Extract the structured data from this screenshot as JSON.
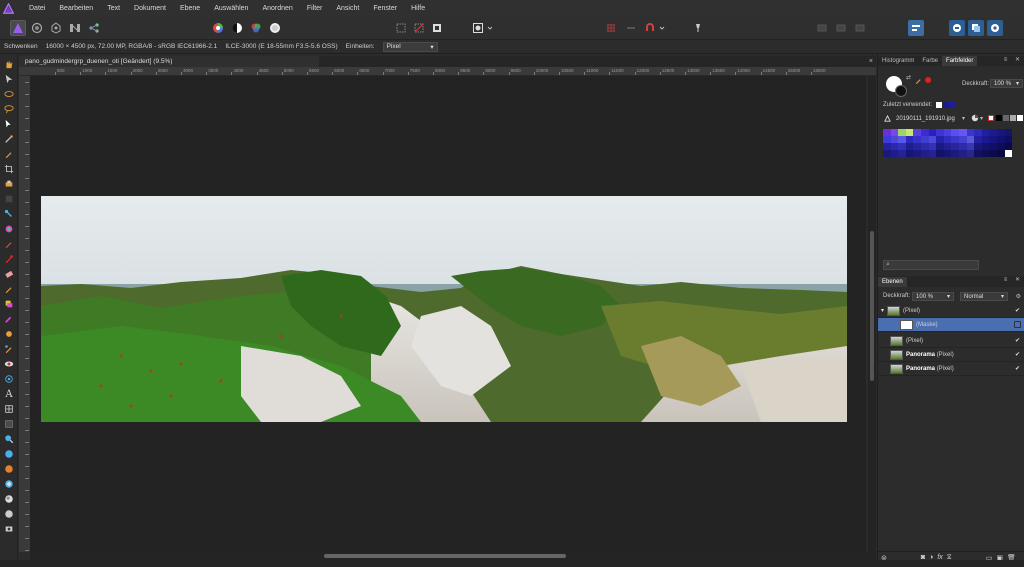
{
  "menu": {
    "items": [
      "Datei",
      "Bearbeiten",
      "Text",
      "Dokument",
      "Ebene",
      "Auswählen",
      "Anordnen",
      "Filter",
      "Ansicht",
      "Fenster",
      "Hilfe"
    ]
  },
  "context": {
    "tool": "Schwenken",
    "info": "16000 × 4500 px, 72.00 MP, RGBA/8 - sRGB IEC61966-2.1",
    "camera": "ILCE-3000 (E 18-55mm F3.5-5.6 OSS)",
    "units_label": "Einheiten:",
    "units_value": "Pixel"
  },
  "document": {
    "tab_title": "pano_gudmindergrp_duenen_oti [Geändert] (9.5%)",
    "ruler_labels": [
      "500",
      "1000",
      "1500",
      "2000",
      "2500",
      "3000",
      "3500",
      "4000",
      "4500",
      "5000",
      "5500",
      "6000",
      "6500",
      "7000",
      "7500",
      "8000",
      "8500",
      "9000",
      "9500",
      "10000",
      "10500",
      "11000",
      "11500",
      "12000",
      "12500",
      "13000",
      "13500",
      "14000",
      "14500",
      "15000",
      "15500"
    ]
  },
  "right_panel": {
    "tabs": [
      "Histogramm",
      "Farbe",
      "Farbfelder"
    ],
    "opacity_label": "Deckkraft:",
    "opacity_value": "100 %",
    "recent_label": "Zuletzt verwendet:",
    "palette_name": "20190111_191910.jpg",
    "recent_colors": [
      "#ffffff",
      "#1a1a8a",
      "#1e1e9a"
    ],
    "palette_rows": [
      [
        "#6a2fd8",
        "#7d44e6",
        "#9cd36a",
        "#c4e872",
        "#5b3fe0",
        "#3b2bd0",
        "#2a1fc0",
        "#3d34d8",
        "#4c3de0",
        "#5a4ef0",
        "#6656f5",
        "#3a36c8",
        "#2c2ac0",
        "#211f9e",
        "#1d1b8c",
        "#19177a",
        "#151468"
      ],
      [
        "#3d3cd8",
        "#4a48e0",
        "#5a58e8",
        "#2b29b8",
        "#3533c8",
        "#403ed0",
        "#4c49d8",
        "#2623a8",
        "#312ebc",
        "#3b37c8",
        "#4541d0",
        "#5c5ad8",
        "#2420a0",
        "#1c1990",
        "#161480",
        "#121070",
        "#0e0d60"
      ],
      [
        "#24229e",
        "#2b28ac",
        "#322fb8",
        "#1f1d92",
        "#26239e",
        "#2d2aaa",
        "#3431b6",
        "#1b1986",
        "#211f92",
        "#28259e",
        "#2f2caa",
        "#3a37b4",
        "#18167c",
        "#141270",
        "#100f64",
        "#0d0c58",
        "#0a094c"
      ],
      [
        "#1a1880",
        "#1f1d8a",
        "#242294",
        "#161474",
        "#1b1980",
        "#201e8a",
        "#252394",
        "#13126a",
        "#171574",
        "#1c1a7e",
        "#211f88",
        "#29278e",
        "#111060",
        "#0e0d56",
        "#0b0a4c",
        "#080842",
        "#ffffff"
      ]
    ],
    "layers_tab": "Ebenen",
    "layer_opacity_label": "Deckkraft:",
    "layer_opacity_value": "100 %",
    "blend_mode": "Normal",
    "layers": [
      {
        "prefix": "",
        "name": "(Pixel)",
        "selected": false,
        "group": true
      },
      {
        "prefix": "",
        "name": "(Maske)",
        "selected": true,
        "group": false
      },
      {
        "prefix": "",
        "name": "(Pixel)",
        "selected": false,
        "group": false
      },
      {
        "prefix": "Panorama",
        "name": "(Pixel)",
        "selected": false,
        "group": false
      },
      {
        "prefix": "Panorama",
        "name": "(Pixel)",
        "selected": false,
        "group": false
      }
    ]
  }
}
